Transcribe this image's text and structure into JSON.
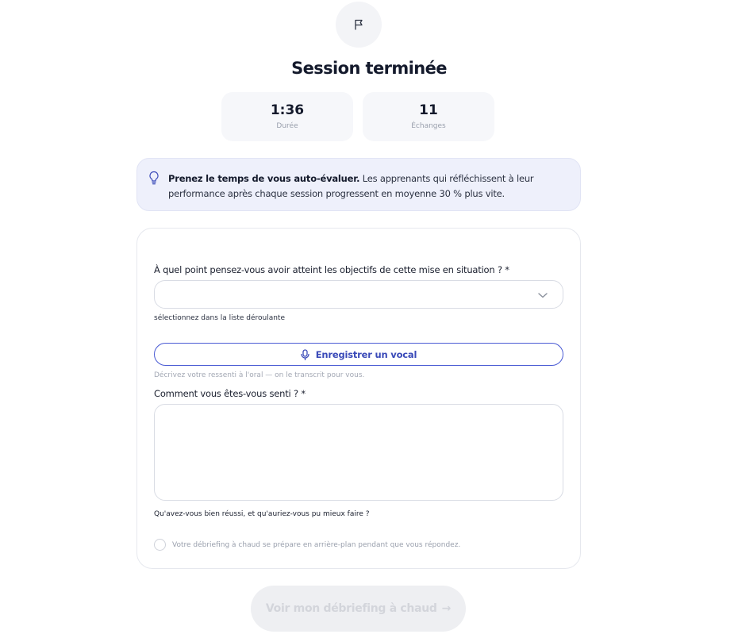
{
  "header": {
    "icon": "flag-icon",
    "title": "Session terminée"
  },
  "stats": [
    {
      "value": "1:36",
      "label": "Durée"
    },
    {
      "value": "11",
      "label": "Échanges"
    }
  ],
  "tip": {
    "icon": "lightbulb-icon",
    "bold": "Prenez le temps de vous auto-évaluer.",
    "text": " Les apprenants qui réfléchissent à leur performance après chaque session progressent en moyenne 30 % plus vite."
  },
  "form": {
    "objective_question": "À quel point pensez-vous avoir atteint les objectifs de cette mise en situation ? *",
    "objective_hint": "sélectionnez dans la liste déroulante",
    "voice_button": "Enregistrer un vocal",
    "voice_hint": "Décrivez votre ressenti à l'oral — on le transcrit pour vous.",
    "feeling_question": "Comment vous êtes-vous senti ? *",
    "feeling_hint": "Qu'avez-vous bien réussi, et qu'auriez-vous pu mieux faire ?",
    "status_text": "Votre débriefing à chaud se prépare en arrière-plan pendant que vous répondez."
  },
  "cta": {
    "label": "Voir mon débriefing à chaud",
    "arrow": "→"
  },
  "colors": {
    "accent": "#3a4ab8",
    "tip_bg": "#eef0fb",
    "disabled_bg": "#eeeff2"
  }
}
